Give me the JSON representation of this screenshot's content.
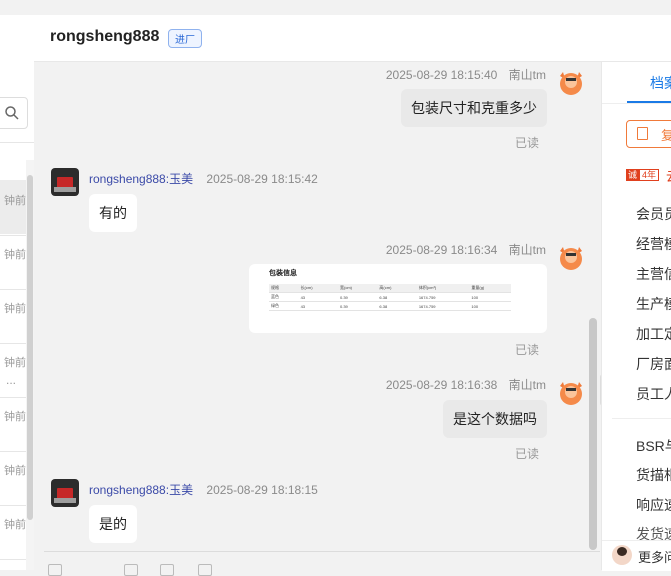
{
  "chat": {
    "contact_name": "rongsheng888",
    "contact_badge": "进厂"
  },
  "conversation_list": {
    "times": [
      "钟前",
      "钟前",
      "钟前",
      "钟前",
      "钟前",
      "钟前",
      "钟前"
    ],
    "more": "..."
  },
  "messages": [
    {
      "side": "right",
      "time": "2025-08-29 18:15:40",
      "sender": "南山tm",
      "text": "包装尺寸和克重多少",
      "status": "已读"
    },
    {
      "side": "left",
      "time": "2025-08-29 18:15:42",
      "sender": "rongsheng888:玉美",
      "text": "有的"
    },
    {
      "side": "right",
      "time": "2025-08-29 18:16:34",
      "sender": "南山tm",
      "status": "已读",
      "image": {
        "title": "包装信息",
        "headers": [
          "规格",
          "长(cm)",
          "宽(cm)",
          "高(cm)",
          "体积(cm³)",
          "重量(g)"
        ],
        "rows": [
          [
            "蓝色",
            "43",
            "0.39",
            "6.38",
            "1674.759",
            "100"
          ],
          [
            "绿色",
            "43",
            "0.39",
            "6.38",
            "1674.759",
            "100"
          ]
        ]
      }
    },
    {
      "side": "right",
      "time": "2025-08-29 18:16:38",
      "sender": "南山tm",
      "text": "是这个数据吗",
      "status": "已读"
    },
    {
      "side": "left",
      "time": "2025-08-29 18:18:15",
      "sender": "rongsheng888:玉美",
      "text": "是的"
    }
  ],
  "right_panel": {
    "tab": "档案",
    "copy_button": "复",
    "years_badge_a": "诚",
    "years_badge_b": "4年",
    "company": "云",
    "items": [
      "会员员",
      "经营模",
      "主营信",
      "生产模",
      "加工定",
      "厂房面",
      "员工人"
    ],
    "items2": [
      "BSR与",
      "货描相",
      "响应速",
      "发货速"
    ],
    "more": "更多问"
  },
  "toggle": "»",
  "colors": {
    "accent": "#1a7ae6",
    "brand_orange": "#f07a3a",
    "link": "#3b4aa8"
  }
}
